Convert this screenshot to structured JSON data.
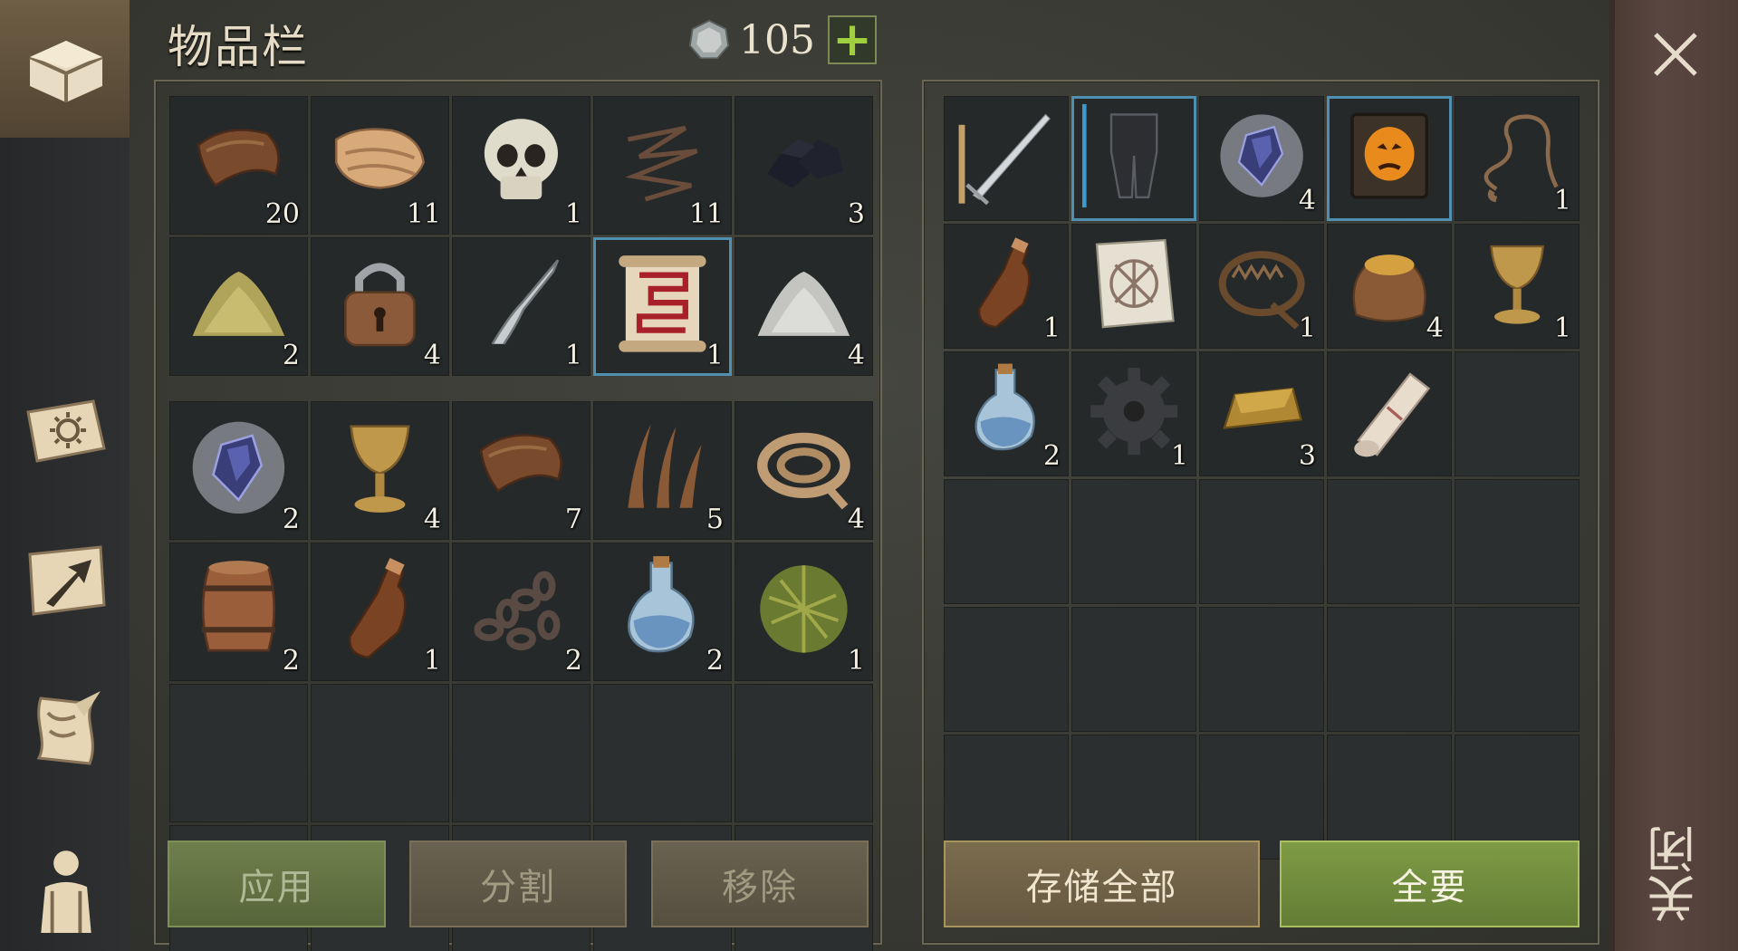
{
  "header": {
    "title": "物品栏",
    "currency_value": "105",
    "currency_icon": "silver-coin-icon",
    "add_currency_icon": "plus-icon"
  },
  "sidebar": {
    "items": [
      {
        "name": "chest-icon",
        "active": true
      },
      {
        "name": "skills-book-icon"
      },
      {
        "name": "map-arrow-icon"
      },
      {
        "name": "scroll-quest-icon"
      },
      {
        "name": "character-icon"
      }
    ]
  },
  "inventory": {
    "section1": [
      {
        "icon": "leather-icon",
        "count": "20"
      },
      {
        "icon": "cloth-icon",
        "count": "11"
      },
      {
        "icon": "skull-icon",
        "count": "1"
      },
      {
        "icon": "wire-icon",
        "count": "11"
      },
      {
        "icon": "coal-icon",
        "count": "3"
      },
      {
        "icon": "sulfur-pile-icon",
        "count": "2"
      },
      {
        "icon": "padlock-icon",
        "count": "4"
      },
      {
        "icon": "lockpick-icon",
        "count": "1"
      },
      {
        "icon": "red-rune-scroll-icon",
        "count": "1",
        "selected": true
      },
      {
        "icon": "salt-pile-icon",
        "count": "4"
      }
    ],
    "section2": [
      {
        "icon": "crystal-icon",
        "count": "2"
      },
      {
        "icon": "goblet-icon",
        "count": "4"
      },
      {
        "icon": "leather-icon",
        "count": "7"
      },
      {
        "icon": "fiber-icon",
        "count": "5"
      },
      {
        "icon": "rope-icon",
        "count": "4"
      },
      {
        "icon": "barrel-icon",
        "count": "2"
      },
      {
        "icon": "bottle-icon",
        "count": "1"
      },
      {
        "icon": "chain-icon",
        "count": "2"
      },
      {
        "icon": "potion-icon",
        "count": "2"
      },
      {
        "icon": "herb-ball-icon",
        "count": "1"
      },
      {
        "icon": "",
        "count": ""
      },
      {
        "icon": "",
        "count": ""
      },
      {
        "icon": "",
        "count": ""
      },
      {
        "icon": "",
        "count": ""
      },
      {
        "icon": "",
        "count": ""
      },
      {
        "icon": "",
        "count": ""
      },
      {
        "icon": "",
        "count": ""
      },
      {
        "icon": "",
        "count": ""
      },
      {
        "icon": "",
        "count": ""
      },
      {
        "icon": "",
        "count": ""
      }
    ]
  },
  "storage": {
    "slots": [
      {
        "icon": "sword-icon",
        "count": ""
      },
      {
        "icon": "leg-armor-icon",
        "count": "",
        "selected": true
      },
      {
        "icon": "crystal-icon",
        "count": "4"
      },
      {
        "icon": "mask-book-icon",
        "count": "",
        "selected": true
      },
      {
        "icon": "whip-icon",
        "count": "1"
      },
      {
        "icon": "bottle-icon",
        "count": "1"
      },
      {
        "icon": "blueprint-icon",
        "count": ""
      },
      {
        "icon": "bear-trap-icon",
        "count": "1"
      },
      {
        "icon": "grain-sack-icon",
        "count": "4"
      },
      {
        "icon": "goblet-icon",
        "count": "1"
      },
      {
        "icon": "potion-icon",
        "count": "2"
      },
      {
        "icon": "gear-icon",
        "count": "1"
      },
      {
        "icon": "gold-ingot-icon",
        "count": "3"
      },
      {
        "icon": "paper-roll-icon",
        "count": ""
      },
      {
        "icon": "",
        "count": ""
      },
      {
        "icon": "",
        "count": ""
      },
      {
        "icon": "",
        "count": ""
      },
      {
        "icon": "",
        "count": ""
      },
      {
        "icon": "",
        "count": ""
      },
      {
        "icon": "",
        "count": ""
      },
      {
        "icon": "",
        "count": ""
      },
      {
        "icon": "",
        "count": ""
      },
      {
        "icon": "",
        "count": ""
      },
      {
        "icon": "",
        "count": ""
      },
      {
        "icon": "",
        "count": ""
      },
      {
        "icon": "",
        "count": ""
      },
      {
        "icon": "",
        "count": ""
      },
      {
        "icon": "",
        "count": ""
      },
      {
        "icon": "",
        "count": ""
      },
      {
        "icon": "",
        "count": ""
      }
    ]
  },
  "buttons": {
    "apply": "应用",
    "split": "分割",
    "remove": "移除",
    "store_all": "存储全部",
    "take_all": "全要"
  },
  "close": {
    "label": "关闭",
    "icon": "close-icon"
  },
  "colors": {
    "accent_green": "#7e9b46",
    "selected_blue": "#4f8fb0",
    "panel_border": "#6b6554"
  }
}
